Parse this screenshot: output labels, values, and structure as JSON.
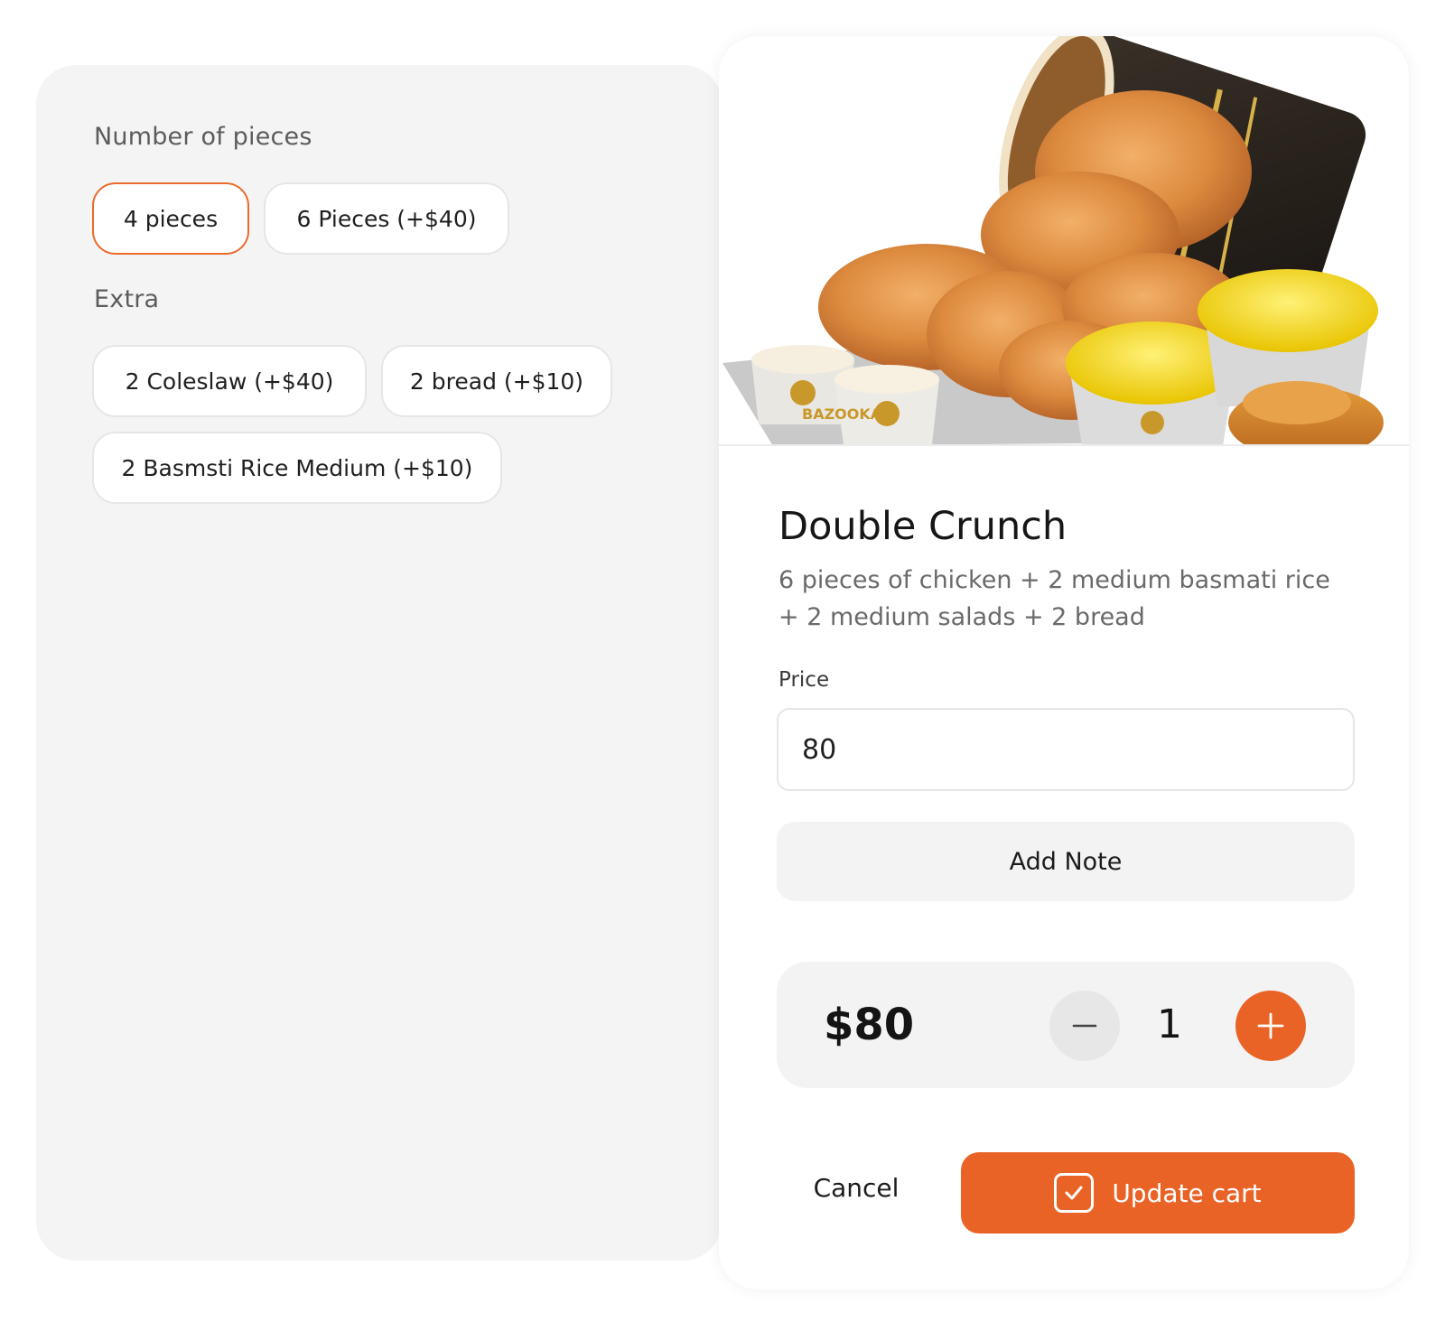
{
  "options": {
    "pieces_label": "Number of pieces",
    "pieces": [
      {
        "label": "4 pieces",
        "selected": true
      },
      {
        "label": "6 Pieces (+$40)",
        "selected": false
      }
    ],
    "extra_label": "Extra",
    "extras": [
      {
        "label": "2 Coleslaw (+$40)"
      },
      {
        "label": "2 bread (+$10)"
      },
      {
        "label": "2 Basmsti Rice Medium (+$10)"
      }
    ]
  },
  "product": {
    "image_label": "BAZOOKA",
    "title": "Double Crunch",
    "description": "6 pieces of chicken + 2 medium basmati rice + 2 medium salads + 2 bread",
    "price_label": "Price",
    "price_value": "80",
    "add_note_label": "Add Note"
  },
  "cart": {
    "total": "$80",
    "quantity": "1",
    "cancel_label": "Cancel",
    "update_label": "Update cart"
  },
  "colors": {
    "accent": "#ea6326",
    "selected_border": "#ea6a2c",
    "panel_bg": "#f4f4f4"
  },
  "icons": {
    "minus": "minus-icon",
    "plus": "plus-icon",
    "check": "checkbox-check-icon"
  }
}
